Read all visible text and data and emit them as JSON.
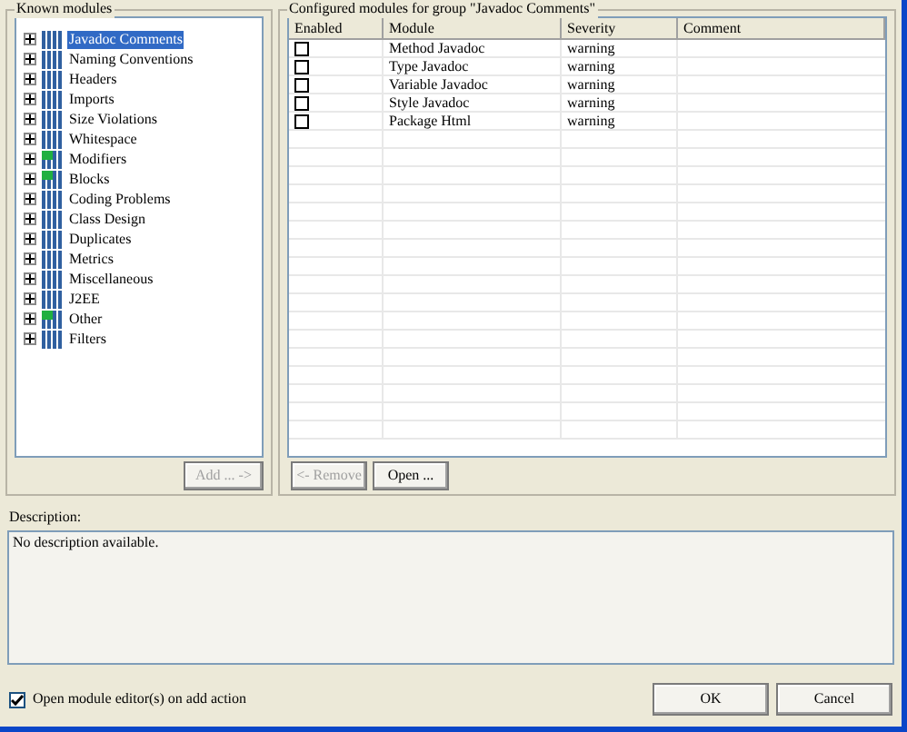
{
  "known_modules": {
    "title": "Known modules",
    "items": [
      {
        "label": "Javadoc Comments",
        "selected": true,
        "checked": false
      },
      {
        "label": "Naming Conventions",
        "selected": false,
        "checked": false
      },
      {
        "label": "Headers",
        "selected": false,
        "checked": false
      },
      {
        "label": "Imports",
        "selected": false,
        "checked": false
      },
      {
        "label": "Size Violations",
        "selected": false,
        "checked": false
      },
      {
        "label": "Whitespace",
        "selected": false,
        "checked": false
      },
      {
        "label": "Modifiers",
        "selected": false,
        "checked": true
      },
      {
        "label": "Blocks",
        "selected": false,
        "checked": true
      },
      {
        "label": "Coding Problems",
        "selected": false,
        "checked": false
      },
      {
        "label": "Class Design",
        "selected": false,
        "checked": false
      },
      {
        "label": "Duplicates",
        "selected": false,
        "checked": false
      },
      {
        "label": "Metrics",
        "selected": false,
        "checked": false
      },
      {
        "label": "Miscellaneous",
        "selected": false,
        "checked": false
      },
      {
        "label": "J2EE",
        "selected": false,
        "checked": false
      },
      {
        "label": "Other",
        "selected": false,
        "checked": true
      },
      {
        "label": "Filters",
        "selected": false,
        "checked": false
      }
    ],
    "add_button": {
      "label": "Add ... ->",
      "disabled": true
    }
  },
  "configured": {
    "title": "Configured modules for group \"Javadoc Comments\"",
    "columns": [
      "Enabled",
      "Module",
      "Severity",
      "Comment"
    ],
    "rows": [
      {
        "enabled": false,
        "module": "Method Javadoc",
        "severity": "warning"
      },
      {
        "enabled": false,
        "module": "Type Javadoc",
        "severity": "warning"
      },
      {
        "enabled": false,
        "module": "Variable Javadoc",
        "severity": "warning"
      },
      {
        "enabled": false,
        "module": "Style Javadoc",
        "severity": "warning"
      },
      {
        "enabled": false,
        "module": "Package Html",
        "severity": "warning"
      }
    ],
    "buttons": [
      {
        "label": "<- Remove",
        "disabled": true
      },
      {
        "label": "Open ...",
        "disabled": false
      }
    ]
  },
  "description": {
    "label": "Description:",
    "value": "No description available."
  },
  "open_editor": {
    "label": "Open module editor(s) on add action",
    "checked": true
  },
  "buttons": [
    "OK",
    "Cancel"
  ]
}
